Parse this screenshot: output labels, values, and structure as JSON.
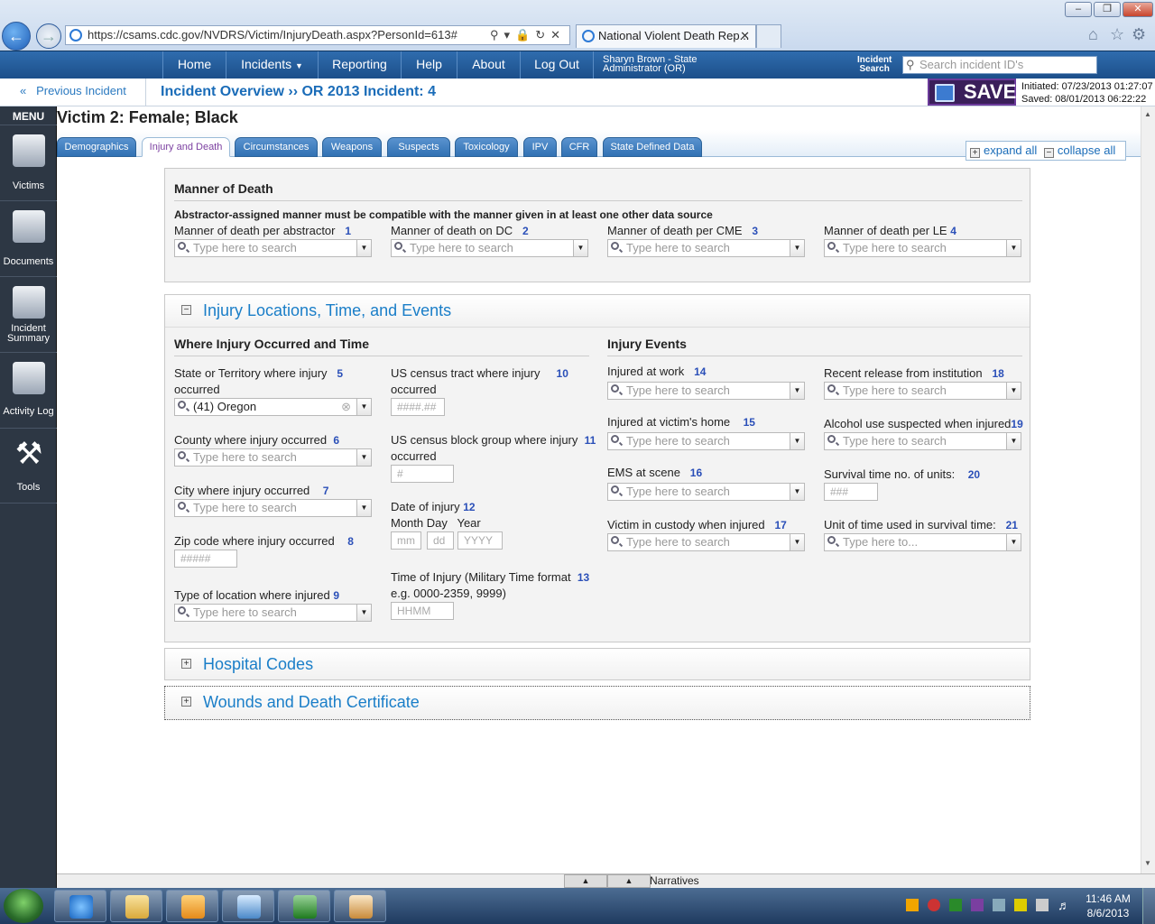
{
  "browser": {
    "window_buttons": [
      "–",
      "❐",
      "✕"
    ],
    "url": "https://csams.cdc.gov/NVDRS/Victim/InjuryDeath.aspx?PersonId=613#",
    "tab_title": "National Violent Death Rep..."
  },
  "topnav": {
    "items": [
      "Home",
      "Incidents",
      "Reporting",
      "Help",
      "About",
      "Log Out"
    ],
    "user_line1": "Sharyn Brown - State",
    "user_line2": "Administrator (OR)",
    "incident_search_label1": "Incident",
    "incident_search_label2": "Search",
    "search_placeholder": "Search incident ID's"
  },
  "bar2": {
    "prev_incident": "Previous Incident",
    "incident_overview": "Incident Overview ›› OR 2013 Incident: 4",
    "save": "SAVE",
    "initiated": "Initiated: 07/23/2013 01:27:07",
    "saved": "Saved: 08/01/2013 06:22:22"
  },
  "sidebar": {
    "menu": "MENU",
    "items": [
      {
        "label": "Victims",
        "icon": "users-icon"
      },
      {
        "label": "Documents",
        "icon": "documents-icon"
      },
      {
        "label": "Incident Summary",
        "icon": "magnifier-document-icon"
      },
      {
        "label": "Activity Log",
        "icon": "clipboard-icon"
      },
      {
        "label": "Tools",
        "icon": "tools-icon"
      }
    ]
  },
  "victim_title": "Victim 2: Female; Black",
  "tabs": [
    "Demographics",
    "Injury and Death",
    "Circumstances",
    "Weapons",
    "Suspects",
    "Toxicology",
    "IPV",
    "CFR",
    "State Defined Data"
  ],
  "active_tab": "Injury and Death",
  "expand_all": "expand all",
  "collapse_all": "collapse all",
  "manner": {
    "title": "Manner of Death",
    "note": "Abstractor-assigned manner must be compatible with the manner given in at least one other data source",
    "fields": [
      {
        "label": "Manner of death per abstractor",
        "num": "1",
        "placeholder": "Type here to search"
      },
      {
        "label": "Manner of death on DC",
        "num": "2",
        "placeholder": "Type here to search"
      },
      {
        "label": "Manner of death per CME",
        "num": "3",
        "placeholder": "Type here to search"
      },
      {
        "label": "Manner of death per LE",
        "num": "4",
        "placeholder": "Type here to search"
      }
    ]
  },
  "injury": {
    "title": "Injury Locations, Time, and Events",
    "where_title": "Where Injury Occurred and Time",
    "events_title": "Injury Events",
    "state": {
      "label1": "State or Territory where injury",
      "label2": "occurred",
      "num": "5",
      "value": "(41) Oregon"
    },
    "county": {
      "label": "County where injury occurred",
      "num": "6",
      "placeholder": "Type here to search"
    },
    "city": {
      "label": "City where injury occurred",
      "num": "7",
      "placeholder": "Type here to search"
    },
    "zip": {
      "label": "Zip code where injury occurred",
      "num": "8",
      "placeholder": "#####"
    },
    "loctype": {
      "label": "Type of location where injured",
      "num": "9",
      "placeholder": "Type here to search"
    },
    "tract": {
      "label1": "US census tract where injury",
      "label2": "occurred",
      "num": "10",
      "placeholder": "####.##"
    },
    "block": {
      "label1": "US census block group where injury",
      "label2": "occurred",
      "num": "11",
      "placeholder": "#"
    },
    "date": {
      "label": "Date of injury",
      "num": "12",
      "sub": "Month Day   Year",
      "mm": "mm",
      "dd": "dd",
      "yyyy": "YYYY"
    },
    "time": {
      "label1": "Time of Injury (Military Time format",
      "label2": "e.g. 0000-2359, 9999)",
      "num": "13",
      "placeholder": "HHMM"
    },
    "events": [
      {
        "label": "Injured at work",
        "num": "14",
        "placeholder": "Type here to search"
      },
      {
        "label": "Injured at victim's home",
        "num": "15",
        "placeholder": "Type here to search"
      },
      {
        "label": "EMS at scene",
        "num": "16",
        "placeholder": "Type here to search"
      },
      {
        "label": "Victim in custody when injured",
        "num": "17",
        "placeholder": "Type here to search"
      },
      {
        "label": "Recent release from institution",
        "num": "18",
        "placeholder": "Type here to search"
      },
      {
        "label": "Alcohol use suspected when injured",
        "num": "19",
        "placeholder": "Type here to search"
      },
      {
        "label": "Survival time no. of units:",
        "num": "20",
        "placeholder": "###"
      },
      {
        "label": "Unit of time used in survival time:",
        "num": "21",
        "placeholder": "Type here to..."
      }
    ]
  },
  "hospital_codes": "Hospital Codes",
  "wounds": "Wounds and Death Certificate",
  "narratives": "Narratives",
  "clock": {
    "time": "11:46 AM",
    "date": "8/6/2013"
  }
}
